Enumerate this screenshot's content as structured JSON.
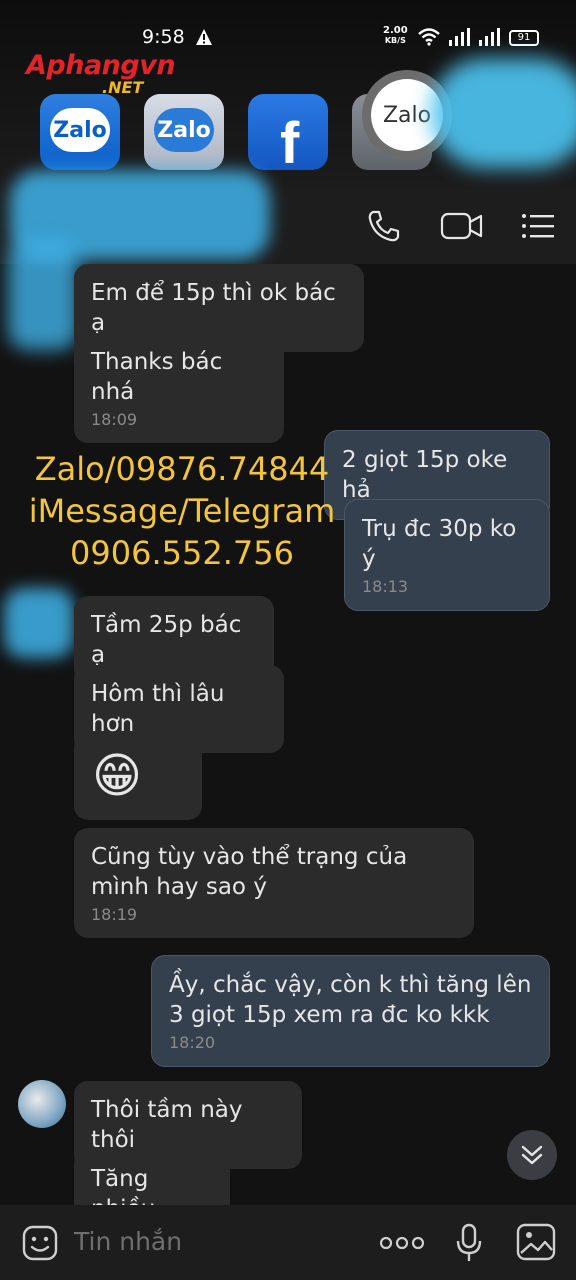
{
  "status": {
    "time": "9:58",
    "speed_top": "2.00",
    "speed_unit": "KB/S",
    "battery": "91"
  },
  "logo": {
    "main": "Aphangvn",
    "sub": ".NET"
  },
  "recents": [
    {
      "label": "Zalo"
    },
    {
      "label": "Zalo"
    },
    {
      "label": "f"
    },
    {
      "label": "Zalo"
    }
  ],
  "watermark": {
    "line1": "Zalo/09876.74844",
    "line2": "iMessage/Telegram",
    "line3": "0906.552.756"
  },
  "messages": [
    {
      "text": "Em để 15p thì ok bác ạ",
      "time": ""
    },
    {
      "text": "Thanks bác nhá",
      "time": "18:09"
    },
    {
      "text": "2 giọt 15p oke hả",
      "time": ""
    },
    {
      "text": "Trụ đc 30p ko ý",
      "time": "18:13"
    },
    {
      "text": "Tầm 25p bác ạ",
      "time": ""
    },
    {
      "text": "Hôm thì lâu hơn",
      "time": ""
    },
    {
      "text": "😁",
      "time": ""
    },
    {
      "text": "Cũng tùy vào thể trạng của mình hay sao ý",
      "time": "18:19"
    },
    {
      "text": "Ầy, chắc vậy, còn k thì tăng lên 3 giọt 15p xem ra đc ko kkk",
      "time": "18:20"
    },
    {
      "text": "Thôi tầm này thôi",
      "time": ""
    },
    {
      "text": "Tăng nhiều",
      "time": ""
    }
  ],
  "input": {
    "placeholder": "Tin nhắn"
  },
  "icons": [
    "phone-icon",
    "video-call-icon",
    "menu-icon",
    "sticker-icon",
    "more-icon",
    "mic-icon",
    "image-icon",
    "scroll-down-icon"
  ]
}
